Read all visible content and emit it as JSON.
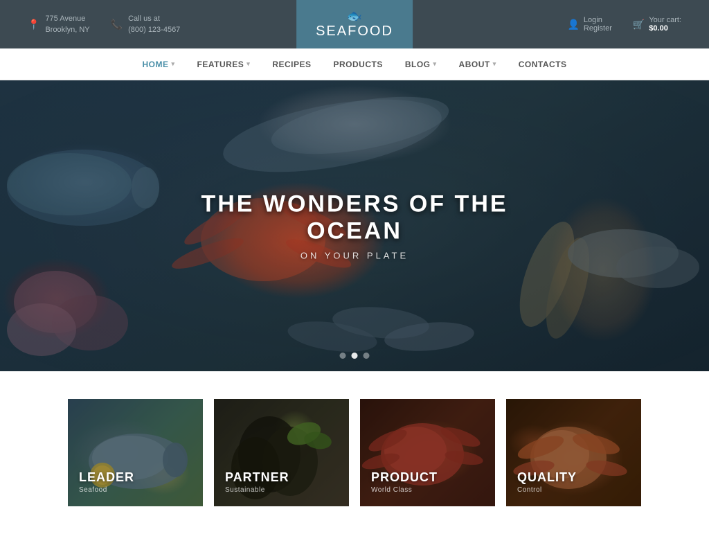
{
  "topbar": {
    "address_icon": "📍",
    "address_line1": "775 Avenue",
    "address_line2": "Brooklyn, NY",
    "phone_icon": "📞",
    "phone_label": "Call us at",
    "phone_number": "(800) 123-4567",
    "logo_sea": "SEA",
    "logo_food": "FOOD",
    "logo_fish_symbol": "🐟",
    "login_icon": "👤",
    "login_label": "Login",
    "register_label": "Register",
    "cart_icon": "🛒",
    "cart_label": "Your cart:",
    "cart_amount": "$0.00"
  },
  "nav": {
    "items": [
      {
        "label": "HOME",
        "has_dropdown": true,
        "active": true
      },
      {
        "label": "FEATURES",
        "has_dropdown": true,
        "active": false
      },
      {
        "label": "RECIPES",
        "has_dropdown": false,
        "active": false
      },
      {
        "label": "PRODUCTS",
        "has_dropdown": false,
        "active": false
      },
      {
        "label": "BLOG",
        "has_dropdown": true,
        "active": false
      },
      {
        "label": "ABOUT",
        "has_dropdown": true,
        "active": false
      },
      {
        "label": "CONTACTS",
        "has_dropdown": false,
        "active": false
      }
    ]
  },
  "hero": {
    "title": "THE WONDERS OF THE OCEAN",
    "subtitle": "ON YOUR PLATE",
    "dots": [
      {
        "active": false
      },
      {
        "active": true
      },
      {
        "active": false
      }
    ]
  },
  "features": {
    "cards": [
      {
        "title": "LEADER",
        "subtitle": "Seafood",
        "bg_class": "card-leader"
      },
      {
        "title": "PARTNER",
        "subtitle": "Sustainable",
        "bg_class": "card-partner"
      },
      {
        "title": "PRODUCT",
        "subtitle": "World Class",
        "bg_class": "card-product"
      },
      {
        "title": "QUALITY",
        "subtitle": "Control",
        "bg_class": "card-quality"
      }
    ]
  },
  "colors": {
    "topbar_bg": "#3d4a52",
    "logo_bg": "#4a7a8e",
    "nav_active": "#4a8fa8"
  }
}
